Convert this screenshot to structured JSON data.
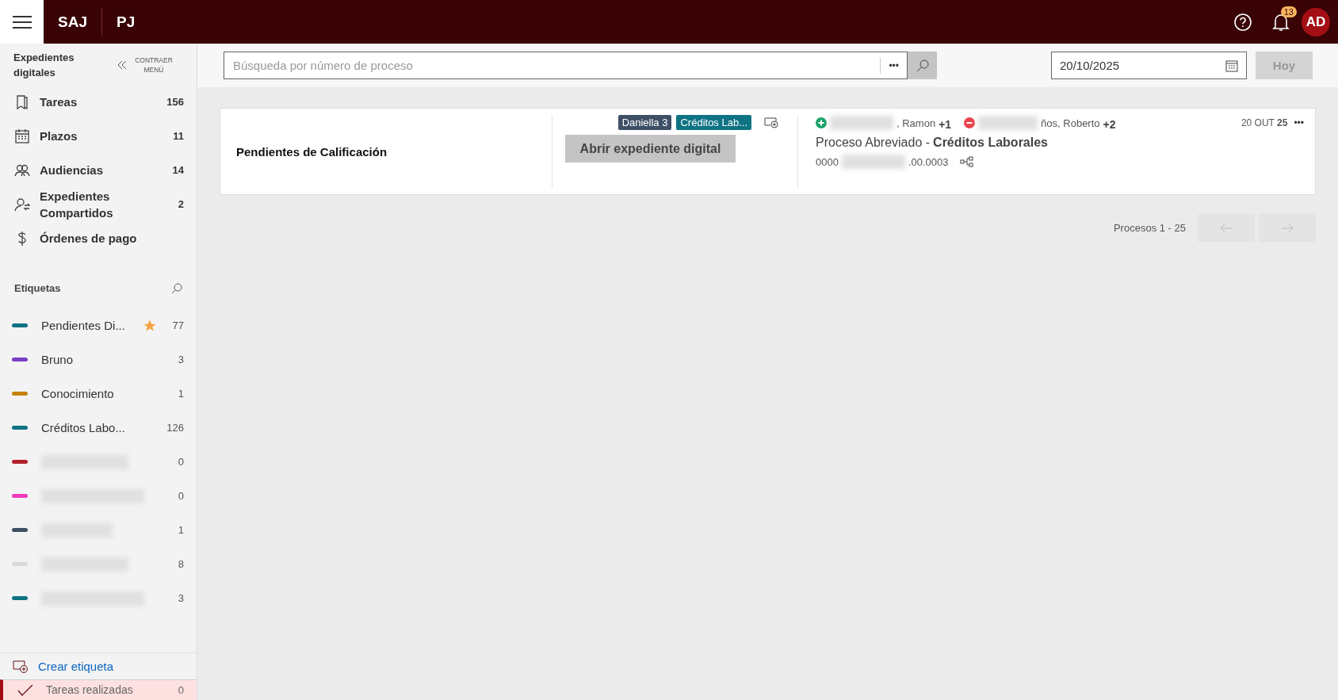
{
  "header": {
    "brand": "SAJ",
    "module": "PJ",
    "notifications": "13",
    "avatar": "AD"
  },
  "sidebar": {
    "title": "Expedientes digitales",
    "collapse_label": "CONTRAER MENÚ",
    "nav": [
      {
        "kind": "bookmark",
        "label": "Tareas",
        "count": "156"
      },
      {
        "kind": "calendar",
        "label": "Plazos",
        "count": "11"
      },
      {
        "kind": "people",
        "label": "Audiencias",
        "count": "14"
      },
      {
        "kind": "shared",
        "label": "Expedientes Compartidos",
        "count": "2"
      },
      {
        "kind": "dollar",
        "label": "Órdenes de pago"
      }
    ],
    "tags_title": "Etiquetas",
    "tags": [
      {
        "label": "Pendientes Di...",
        "count": "77",
        "color": "#0e7383",
        "starred": true,
        "redacted": false
      },
      {
        "label": "Bruno",
        "count": "3",
        "color": "#7b3fc4",
        "starred": false,
        "redacted": false
      },
      {
        "label": "Conocimiento",
        "count": "1",
        "color": "#c4820e",
        "starred": false,
        "redacted": false
      },
      {
        "label": "Créditos Labo...",
        "count": "126",
        "color": "#0e7383",
        "starred": false,
        "redacted": false
      },
      {
        "count": "0",
        "color": "#b3202a",
        "starred": false,
        "redacted": true
      },
      {
        "count": "0",
        "color": "#f03cbe",
        "starred": false,
        "redacted": true
      },
      {
        "count": "1",
        "color": "#3d5066",
        "starred": false,
        "redacted": true
      },
      {
        "count": "8",
        "color": "#d9d9d9",
        "starred": false,
        "redacted": true
      },
      {
        "count": "3",
        "color": "#0e7383",
        "starred": false,
        "redacted": true
      }
    ],
    "create_tag": "Crear etiqueta",
    "done": {
      "label": "Tareas realizadas",
      "count": "0",
      "selected": true
    }
  },
  "toolbar": {
    "search_placeholder": "Búsqueda por número de proceso",
    "more": "•••",
    "date": "20/10/2025",
    "today": "Hoy"
  },
  "results": [
    {
      "group": "Pendientes de Calificación",
      "tags": [
        {
          "label": "Daniella 3",
          "color": "#3d5066"
        },
        {
          "label": "Créditos Lab...",
          "color": "#0e7383"
        }
      ],
      "open_button": "Abrir expediente digital",
      "active_party": ", Ramon",
      "active_extra": "+1",
      "passive_party": "ños, Roberto",
      "passive_extra": "+2",
      "class": "Proceso Abreviado - ",
      "subject": "Créditos Laborales",
      "number_start": "0000",
      "number_end": ".00.0003",
      "date_day": "20 OUT",
      "date_year": "25",
      "menu": "•••"
    }
  ],
  "pagination": {
    "label": "Procesos 1 - 25"
  }
}
